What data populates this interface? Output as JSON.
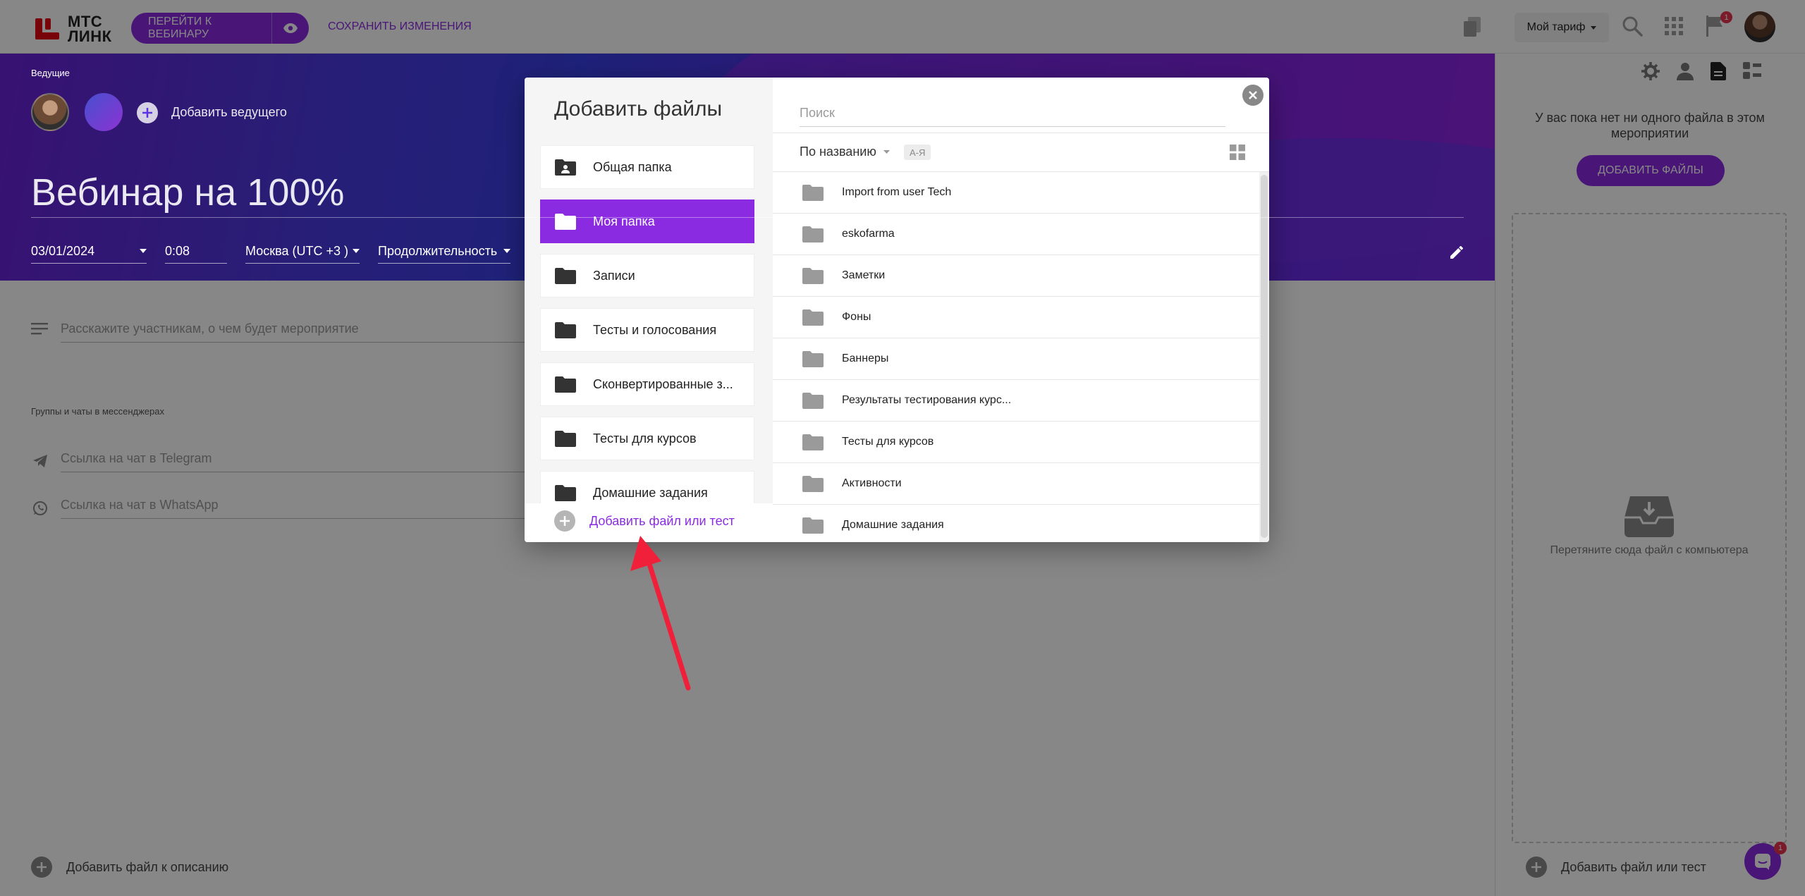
{
  "header": {
    "logo_text_1": "МТС",
    "logo_text_2": "ЛИНК",
    "go_webinar": "ПЕРЕЙТИ К ВЕБИНАРУ",
    "save_changes": "СОХРАНИТЬ ИЗМЕНЕНИЯ",
    "tariff": "Мой тариф",
    "notification_count": "1"
  },
  "event": {
    "hosts_label": "Ведущие",
    "add_host": "Добавить ведущего",
    "title": "Вебинар на 100%",
    "date": "03/01/2024",
    "time": "0:08",
    "timezone": "Москва (UTC +3 )",
    "duration": "Продолжительность",
    "description_placeholder": "Расскажите участникам, о чем будет мероприятие",
    "groups_label": "Группы и чаты в мессенджерах",
    "telegram_placeholder": "Ссылка на чат в Telegram",
    "whatsapp_placeholder": "Ссылка на чат в WhatsApp",
    "add_file_to_description": "Добавить файл к описанию"
  },
  "sidebar": {
    "empty_text": "У вас пока нет ни одного файла в этом мероприятии",
    "add_files_button": "ДОБАВИТЬ ФАЙЛЫ",
    "drop_text": "Перетяните сюда файл с компьютера",
    "add_file_or_test": "Добавить файл или тест",
    "chat_badge": "1"
  },
  "modal": {
    "title": "Добавить файлы",
    "folders": [
      {
        "label": "Общая папка",
        "active": false
      },
      {
        "label": "Моя папка",
        "active": true
      },
      {
        "label": "Записи",
        "active": false
      },
      {
        "label": "Тесты и голосования",
        "active": false
      },
      {
        "label": "Сконвертированные з...",
        "active": false
      },
      {
        "label": "Тесты для курсов",
        "active": false
      },
      {
        "label": "Домашние задания",
        "active": false
      }
    ],
    "add_file_or_test": "Добавить файл или тест",
    "search_placeholder": "Поиск",
    "sort_by": "По названию",
    "sort_order": "А-Я",
    "files": [
      "Import from user Tech",
      "eskofarma",
      "Заметки",
      "Фоны",
      "Баннеры",
      "Результаты тестирования курс...",
      "Тесты для курсов",
      "Активности",
      "Домашние задания"
    ]
  },
  "colors": {
    "accent": "#8a2be2",
    "badge": "#e8344e",
    "arrow": "#f0203a"
  }
}
